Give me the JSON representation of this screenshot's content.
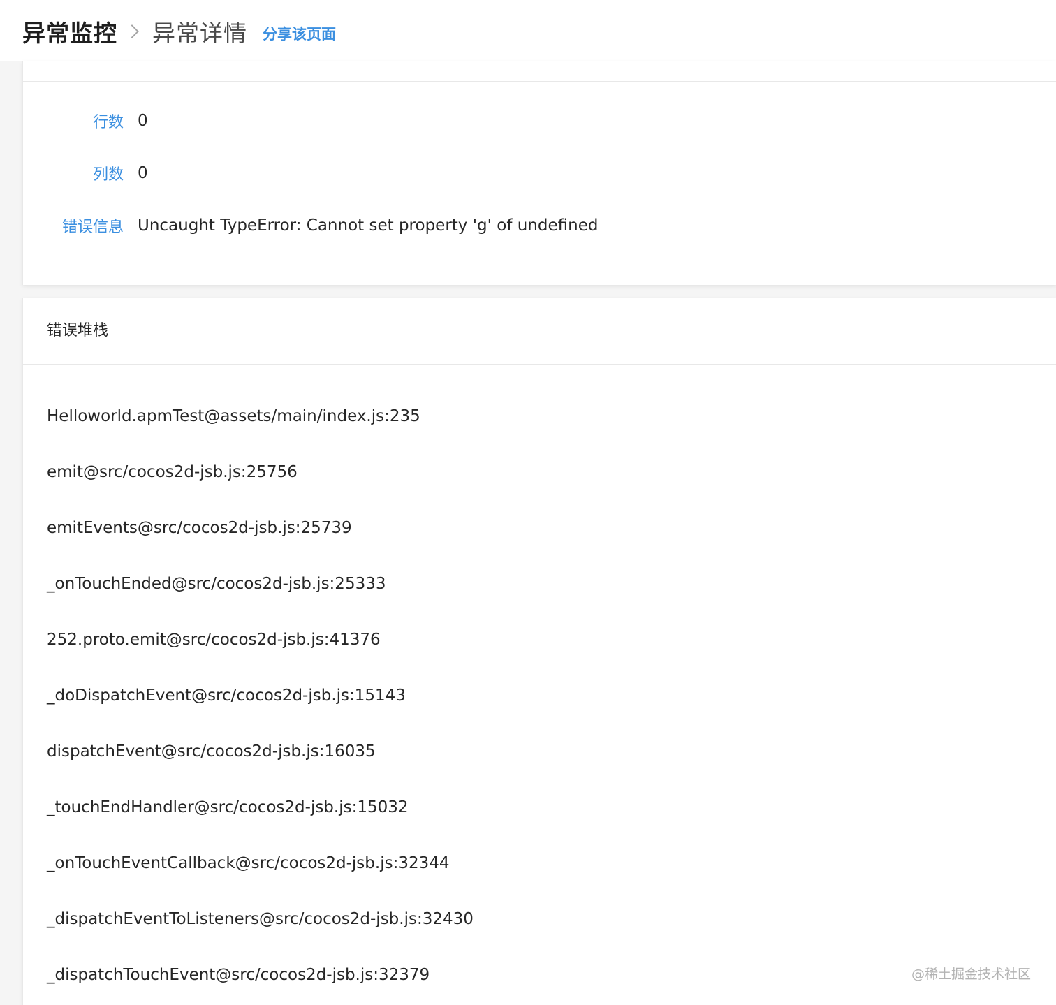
{
  "breadcrumb": {
    "root": "异常监控",
    "current": "异常详情",
    "share": "分享该页面"
  },
  "info": {
    "fields": [
      {
        "label": "行数",
        "value": "0"
      },
      {
        "label": "列数",
        "value": "0"
      },
      {
        "label": "错误信息",
        "value": "Uncaught TypeError: Cannot set property 'g' of undefined"
      }
    ]
  },
  "stack": {
    "title": "错误堆栈",
    "lines": [
      "Helloworld.apmTest@assets/main/index.js:235",
      "emit@src/cocos2d-jsb.js:25756",
      "emitEvents@src/cocos2d-jsb.js:25739",
      "_onTouchEnded@src/cocos2d-jsb.js:25333",
      "252.proto.emit@src/cocos2d-jsb.js:41376",
      "_doDispatchEvent@src/cocos2d-jsb.js:15143",
      "dispatchEvent@src/cocos2d-jsb.js:16035",
      "_touchEndHandler@src/cocos2d-jsb.js:15032",
      "_onTouchEventCallback@src/cocos2d-jsb.js:32344",
      "_dispatchEventToListeners@src/cocos2d-jsb.js:32430",
      "_dispatchTouchEvent@src/cocos2d-jsb.js:32379"
    ]
  },
  "watermark": "@稀土掘金技术社区",
  "colors": {
    "link": "#3b8fe0",
    "label": "#3b8fe0",
    "text": "#262626",
    "background": "#f5f5f5"
  }
}
